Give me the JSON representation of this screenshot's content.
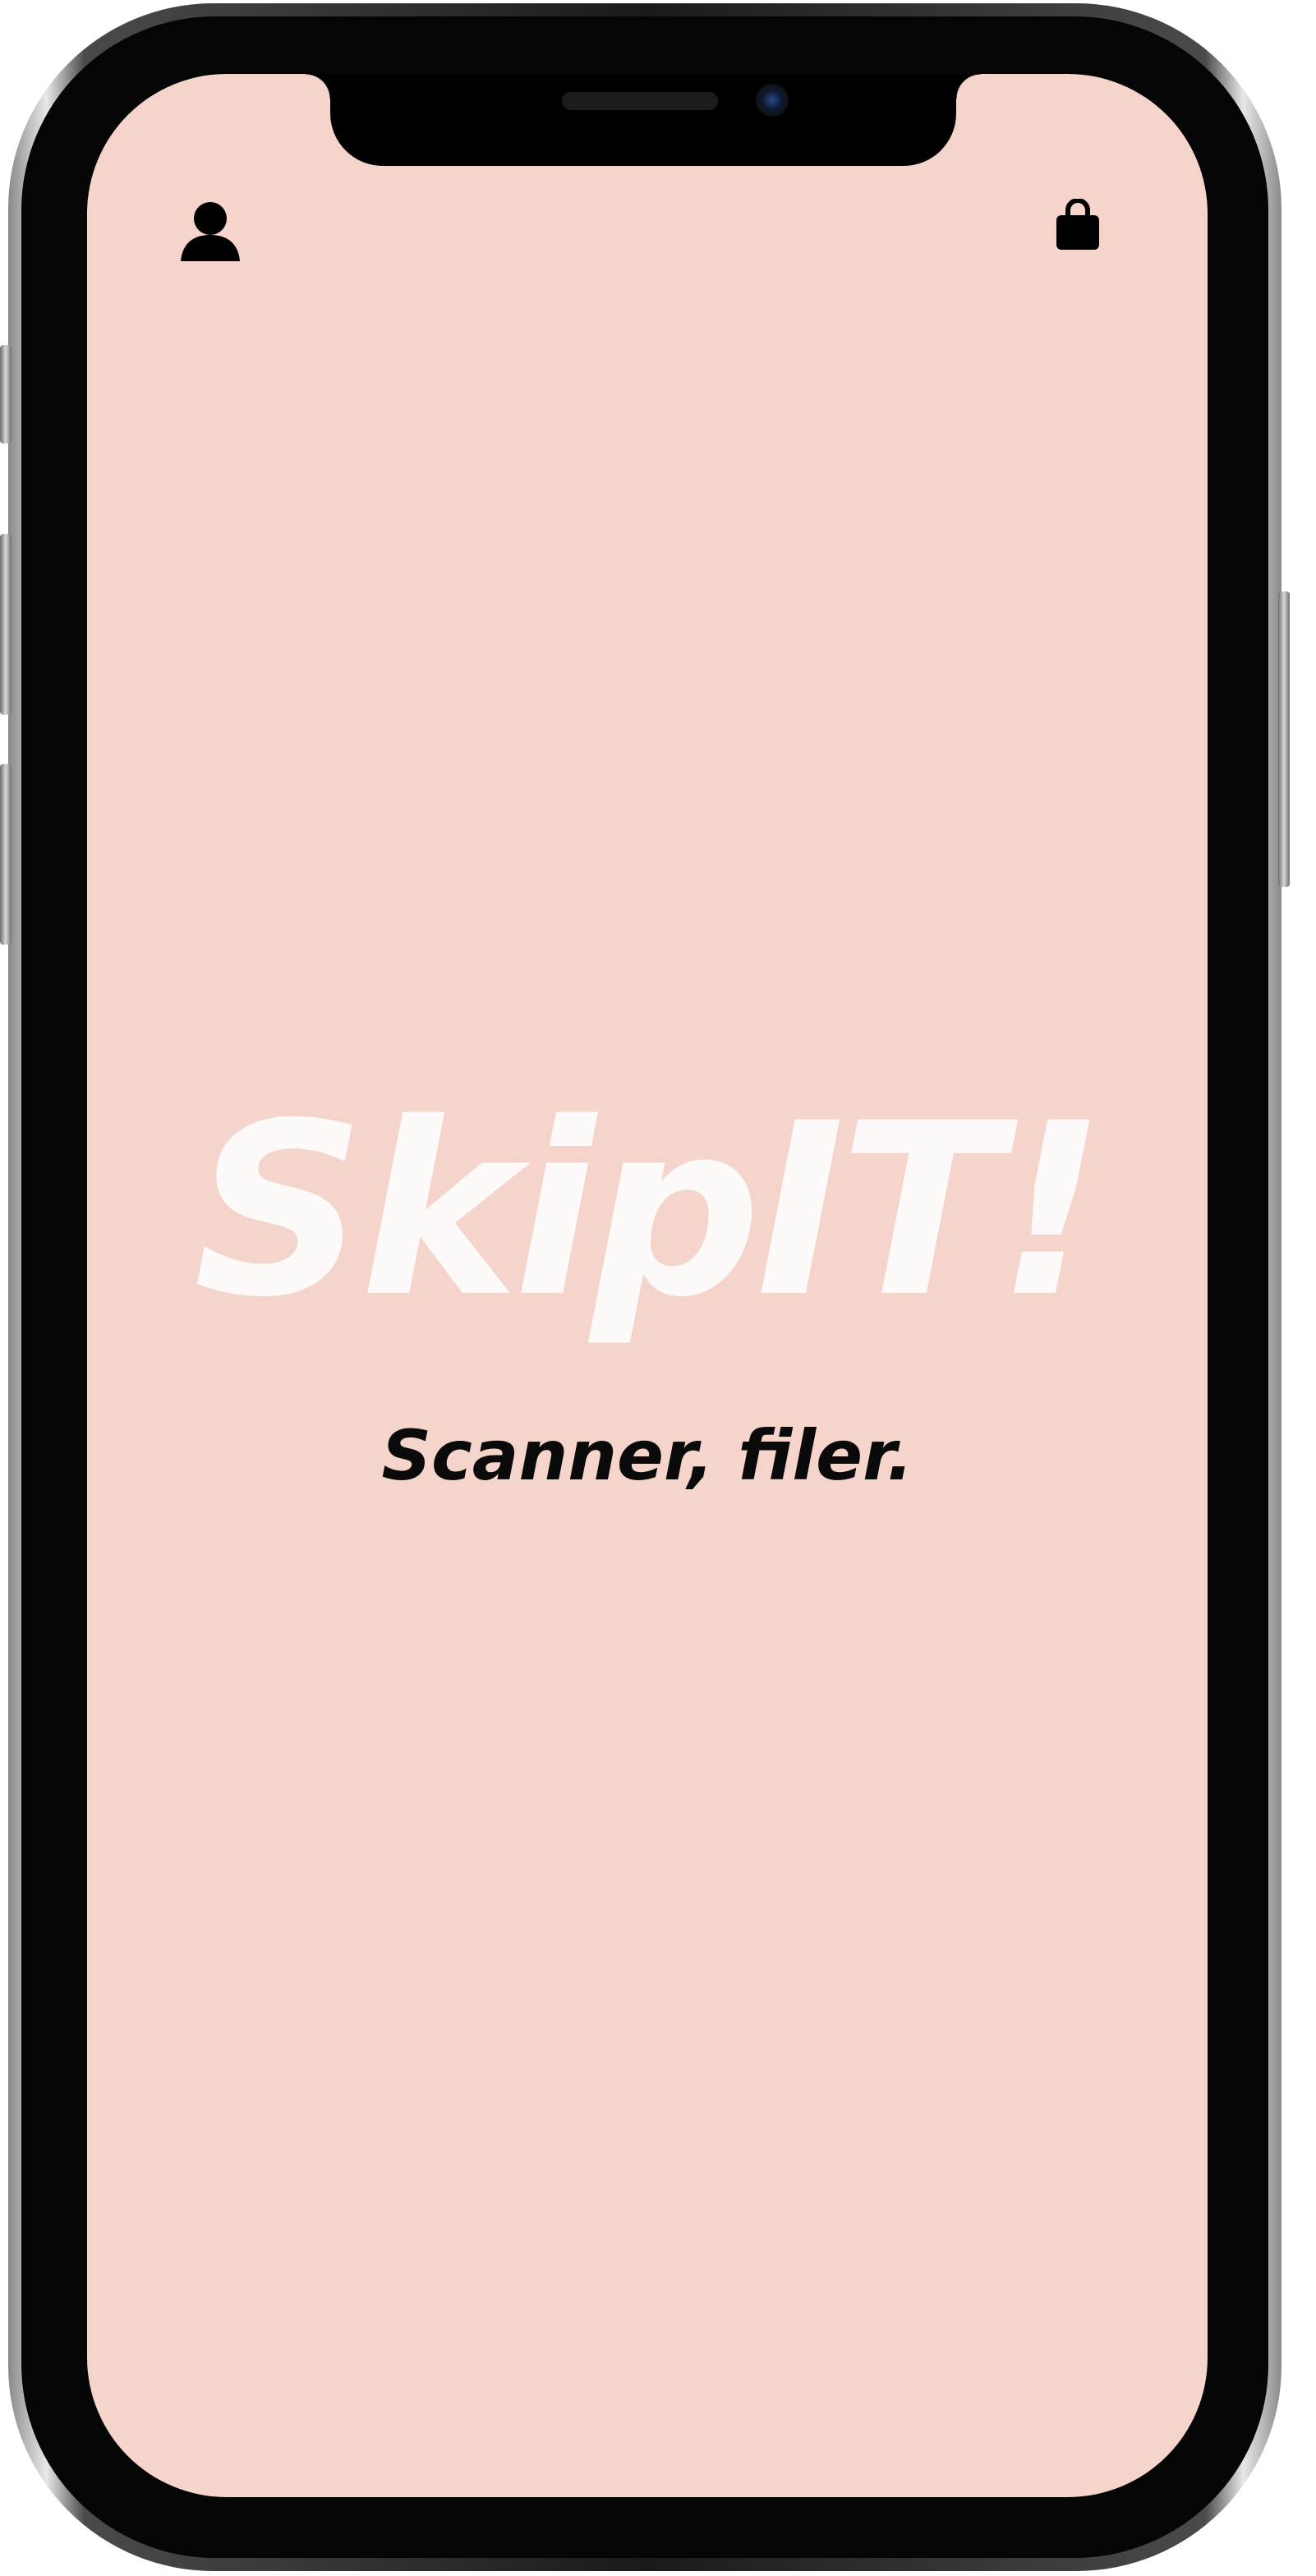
{
  "header": {
    "left_icon": "profile-icon",
    "right_icon": "shopping-bag-icon"
  },
  "main": {
    "brand_title": "SkipIT!",
    "tagline": "Scanner, filer."
  },
  "colors": {
    "background": "#f4d4cb",
    "brand_text": "#fdfaf9",
    "tagline_text": "#0a0a0a",
    "icons": "#000000"
  }
}
